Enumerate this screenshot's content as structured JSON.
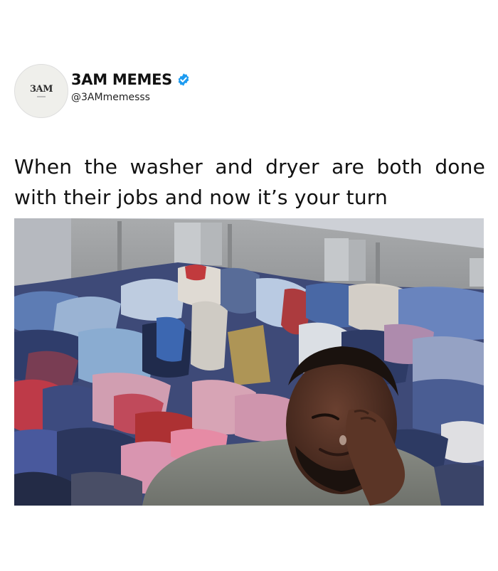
{
  "post": {
    "avatar_text": "3AM",
    "display_name": "3AM MEMES",
    "verified_icon": "verified-badge-icon",
    "handle": "@3AMmemesss",
    "caption": "When the washer and dryer are both done with their jobs and now it’s your turn"
  },
  "image": {
    "subject": "crying man in front of huge pile of clothes",
    "colors": {
      "verified": "#1d9bf0",
      "sky": "#c9ccd3",
      "wall": "#9a9c9e"
    }
  }
}
